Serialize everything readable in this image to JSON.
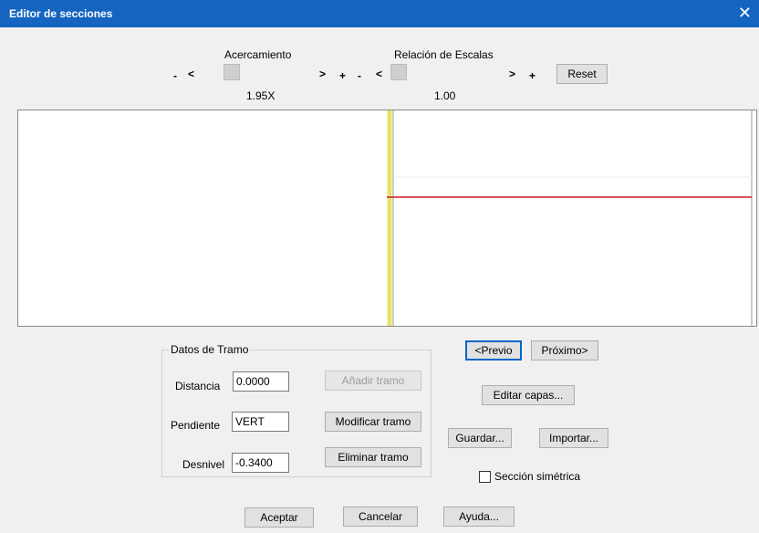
{
  "window": {
    "title": "Editor de secciones",
    "close_glyph": "✕"
  },
  "zoom": {
    "label": "Acercamiento",
    "minus": "-",
    "left": "<",
    "right": ">",
    "plus": "+",
    "value": "1.95X"
  },
  "scale": {
    "label": "Relación de Escalas",
    "minus": "-",
    "left": "<",
    "right": ">",
    "plus": "+",
    "value": "1.00"
  },
  "reset_label": "Reset",
  "graph": {
    "red_line_y_data": 0
  },
  "segment": {
    "group_label": "Datos de Tramo",
    "distance_label": "Distancia",
    "distance_value": "0.0000",
    "slope_label": "Pendiente",
    "slope_value": "VERT",
    "drop_label": "Desnivel",
    "drop_value": "-0.3400",
    "add_label": "Añadir tramo",
    "modify_label": "Modificar tramo",
    "delete_label": "Eliminar tramo"
  },
  "nav": {
    "prev_label": "<Previo",
    "next_label": "Próximo>"
  },
  "edit_layers_label": "Editar capas...",
  "save_label": "Guardar...",
  "import_label": "Importar...",
  "symmetric": {
    "label": "Sección simétrica",
    "checked": false
  },
  "footer": {
    "accept_label": "Aceptar",
    "cancel_label": "Cancelar",
    "help_label": "Ayuda..."
  },
  "colors": {
    "titlebar": "#1565c0",
    "axis_yellow": "#e6e26a",
    "line_red": "#cc1b1b"
  }
}
